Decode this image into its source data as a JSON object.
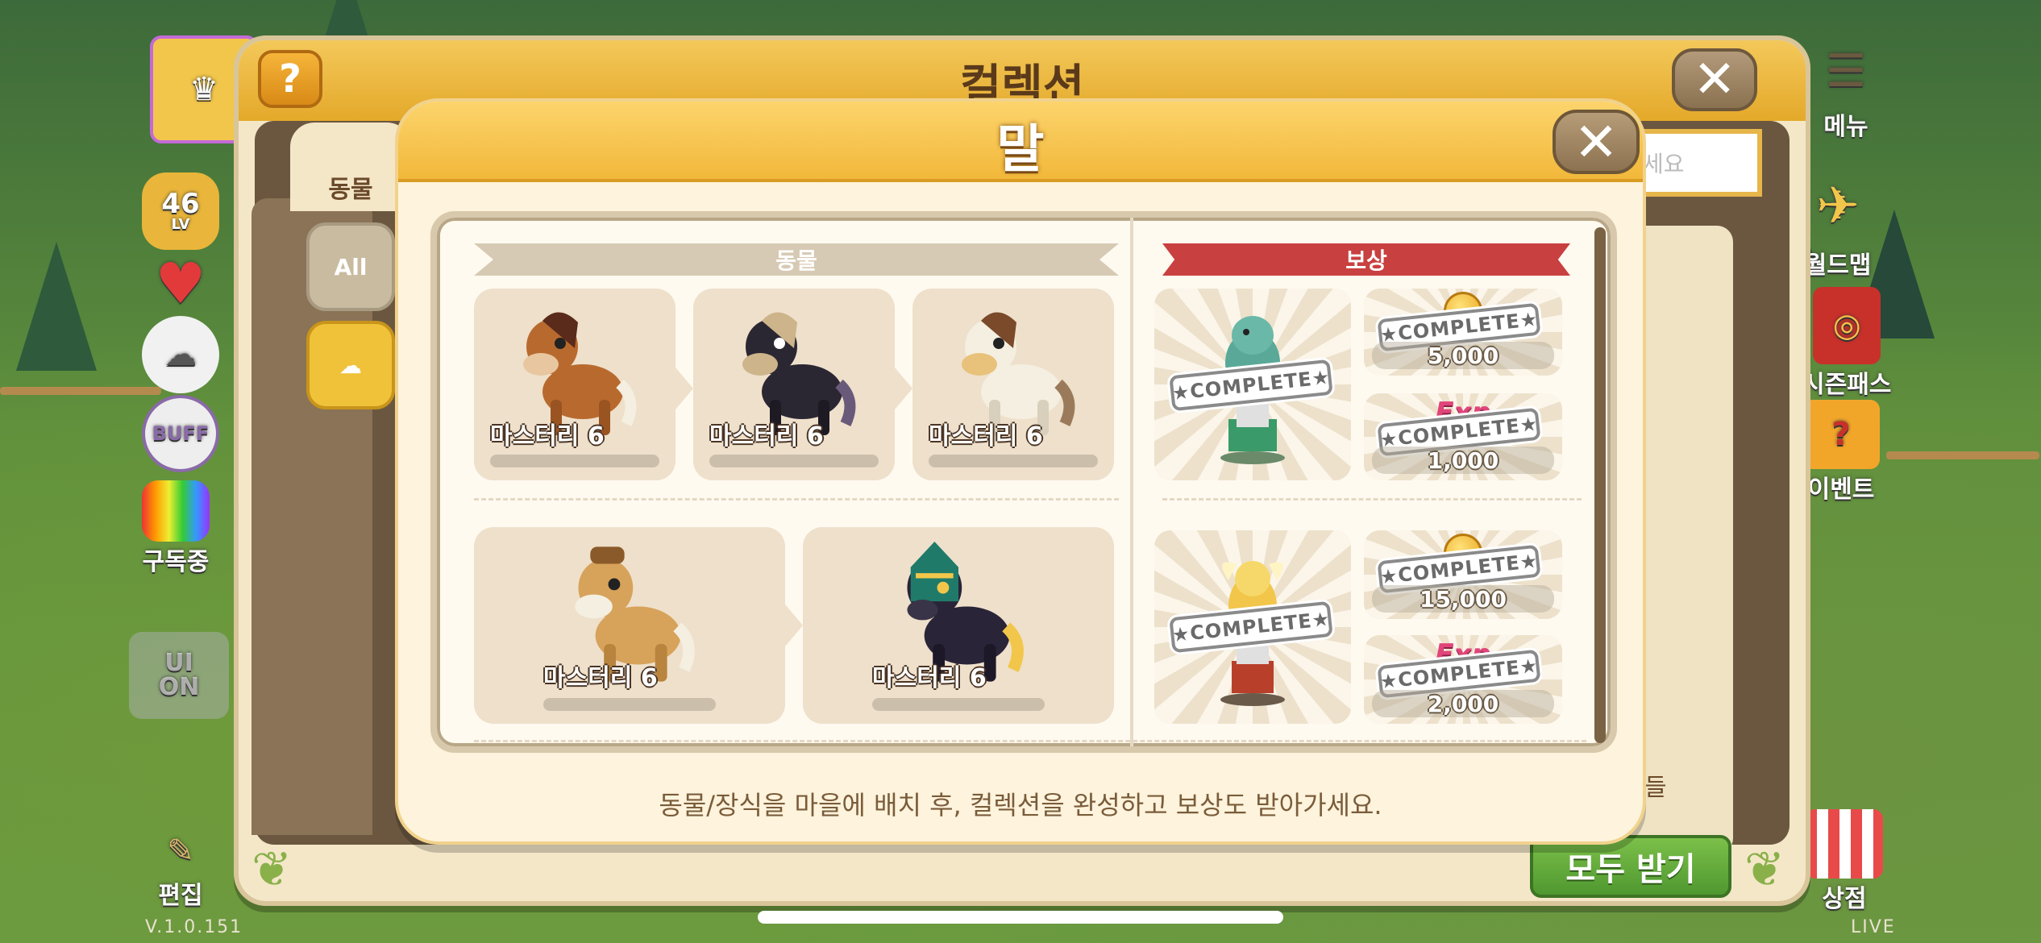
{
  "background": {
    "left_buttons": [
      {
        "label": "",
        "icon": "profile-avatar-icon"
      },
      {
        "label": "46",
        "sub": "LV",
        "icon": "level-star-icon"
      },
      {
        "label": "",
        "icon": "heart-icon"
      },
      {
        "label": "",
        "icon": "sheep-icon"
      },
      {
        "label": "BUFF",
        "icon": "buff-icon"
      },
      {
        "label": "구독중",
        "icon": "tv-icon"
      },
      {
        "label": "UI\nON",
        "icon": "ui-toggle-icon"
      },
      {
        "label": "편집",
        "icon": "brush-icon"
      }
    ],
    "right_buttons": [
      {
        "label": "메뉴",
        "icon": "menu-icon"
      },
      {
        "label": "월드맵",
        "icon": "plane-icon"
      },
      {
        "label": "시즌패스",
        "icon": "passport-icon"
      },
      {
        "label": "이벤트",
        "icon": "gift-icon"
      },
      {
        "label": "상점",
        "icon": "shop-icon"
      }
    ],
    "version": "V.1.0.151",
    "live": "LIVE"
  },
  "outer_panel": {
    "title": "컬렉션",
    "help_label": "?",
    "close_label": "✕",
    "tab_label": "동물",
    "filters": [
      "All",
      ""
    ],
    "search_placeholder": "세요",
    "list_label": "들",
    "receive_all_label": "모두 받기"
  },
  "modal": {
    "title": "말",
    "close_label": "✕",
    "animals_header": "동물",
    "reward_header": "보상",
    "footer": "동물/장식을 마을에 배치 후, 컬렉션을 완성하고 보상도 받아가세요.",
    "complete_label": "★COMPLETE★",
    "row1_animals": [
      {
        "mastery": "마스터리 6",
        "color": "#b86a2e",
        "mane": "#5a2a1a"
      },
      {
        "mastery": "마스터리 6",
        "color": "#2b2732",
        "mane": "#cdb48a"
      },
      {
        "mastery": "마스터리 6",
        "color": "#f4efe0",
        "mane": "#7a4a2a"
      }
    ],
    "row2_animals": [
      {
        "mastery": "마스터리 6",
        "color": "#d7a25a",
        "mane": "#8a5a2a"
      },
      {
        "mastery": "마스터리 6",
        "color": "#2a2438",
        "mane": "#1f7a6a"
      }
    ],
    "rewards": [
      {
        "item_icon": "horse-statue-icon",
        "small": [
          {
            "type": "coin",
            "amount": "5,000"
          },
          {
            "type": "exp",
            "amount": "1,000"
          }
        ]
      },
      {
        "item_icon": "golden-horse-statue-icon",
        "small": [
          {
            "type": "coin",
            "amount": "15,000"
          },
          {
            "type": "exp",
            "amount": "2,000"
          }
        ]
      }
    ],
    "exp_label": "Exp"
  }
}
